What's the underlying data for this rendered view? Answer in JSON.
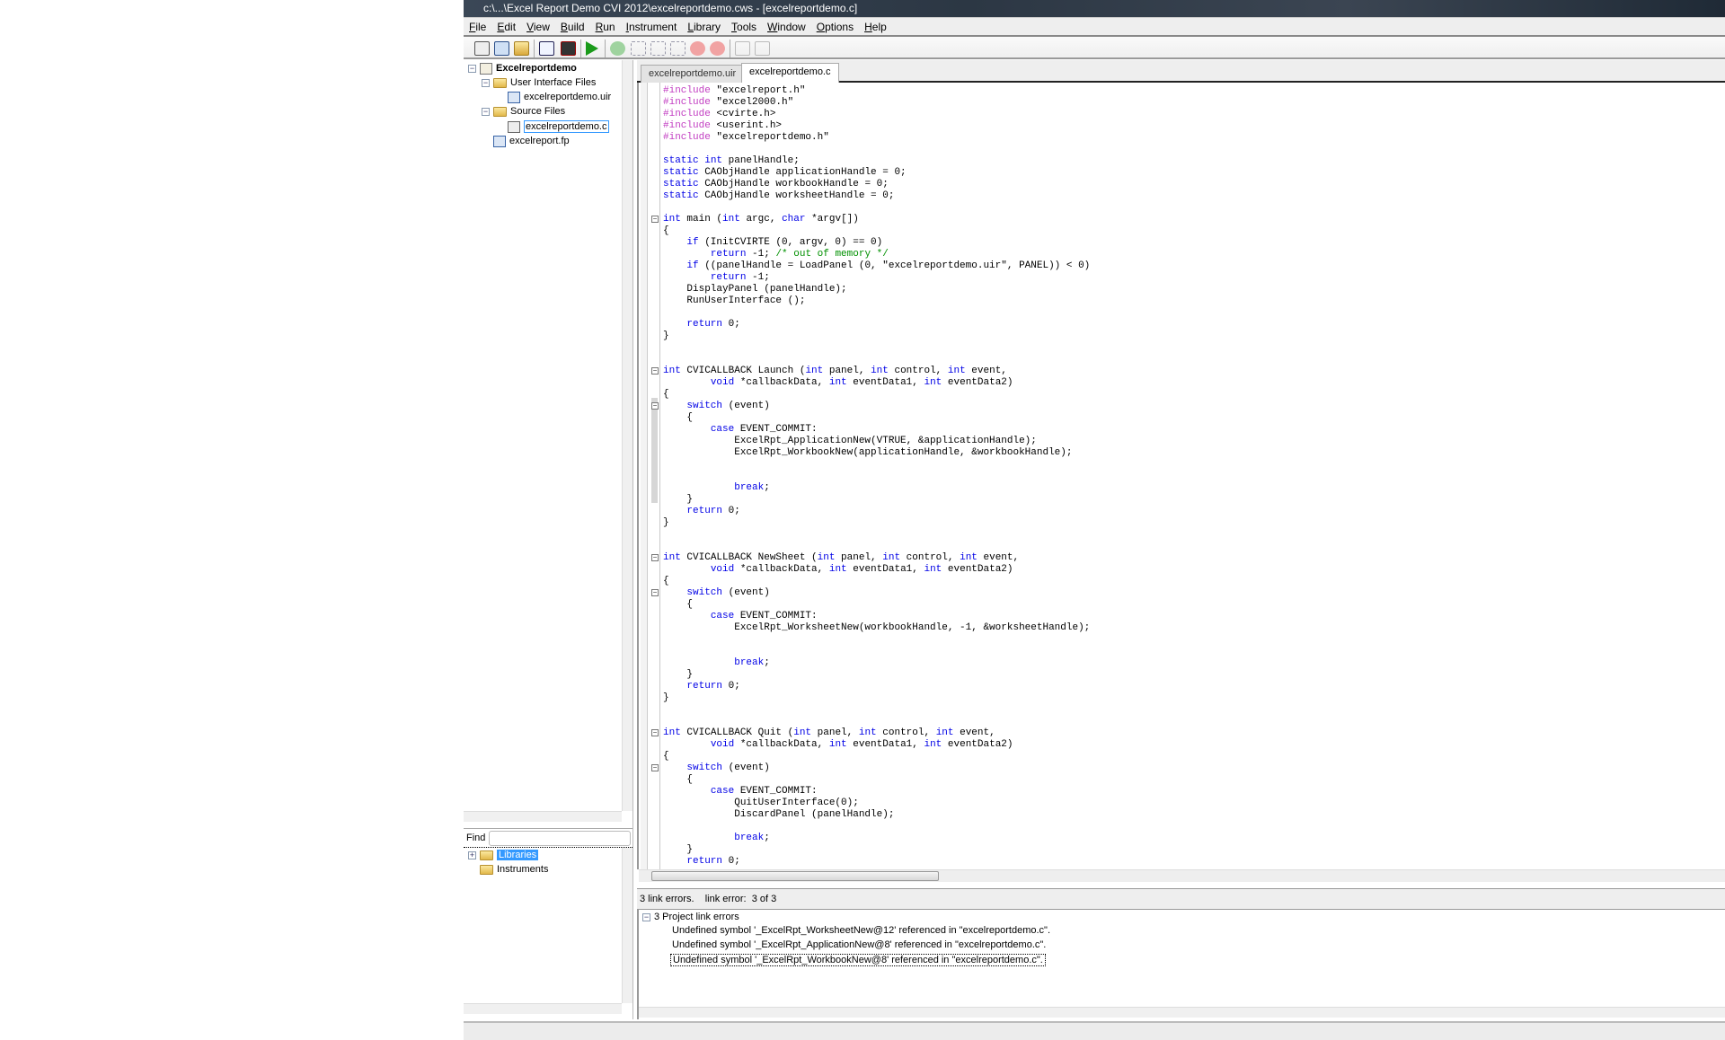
{
  "window": {
    "title": "c:\\...\\Excel Report Demo CVI 2012\\excelreportdemo.cws - [excelreportdemo.c]"
  },
  "menu": [
    "File",
    "Edit",
    "View",
    "Build",
    "Run",
    "Instrument",
    "Library",
    "Tools",
    "Window",
    "Options",
    "Help"
  ],
  "toolbar": {
    "icons": [
      "new-source-icon",
      "new-uir-icon",
      "open-icon",
      "function-tree-icon",
      "debug-target-icon",
      "run-icon",
      "go-icon",
      "step-into-icon",
      "step-over-icon",
      "step-out-icon",
      "stop-icon",
      "terminate-icon",
      "toggle-breakpoint-icon",
      "breakpoints-icon"
    ]
  },
  "project_tree": {
    "root": "Excelreportdemo",
    "user_interface_folder": "User Interface Files",
    "uir_file": "excelreportdemo.uir",
    "source_folder": "Source Files",
    "source_file": "excelreportdemo.c",
    "fp_file": "excelreport.fp"
  },
  "find": {
    "label": "Find",
    "value": ""
  },
  "library_tree": {
    "libraries": "Libraries",
    "instruments": "Instruments"
  },
  "tabs": [
    {
      "label": "excelreportdemo.uir",
      "active": false
    },
    {
      "label": "excelreportdemo.c",
      "active": true
    }
  ],
  "code": {
    "lines": [
      [
        [
          "p",
          "#include"
        ],
        [
          "t",
          " \"excelreport.h\""
        ]
      ],
      [
        [
          "p",
          "#include"
        ],
        [
          "t",
          " \"excel2000.h\""
        ]
      ],
      [
        [
          "p",
          "#include"
        ],
        [
          "t",
          " <cvirte.h>"
        ]
      ],
      [
        [
          "p",
          "#include"
        ],
        [
          "t",
          " <userint.h>"
        ]
      ],
      [
        [
          "p",
          "#include"
        ],
        [
          "t",
          " \"excelreportdemo.h\""
        ]
      ],
      [],
      [
        [
          "k",
          "static"
        ],
        [
          "t",
          " "
        ],
        [
          "k",
          "int"
        ],
        [
          "t",
          " panelHandle;"
        ]
      ],
      [
        [
          "k",
          "static"
        ],
        [
          "t",
          " CAObjHandle applicationHandle = 0;"
        ]
      ],
      [
        [
          "k",
          "static"
        ],
        [
          "t",
          " CAObjHandle workbookHandle = 0;"
        ]
      ],
      [
        [
          "k",
          "static"
        ],
        [
          "t",
          " CAObjHandle worksheetHandle = 0;"
        ]
      ],
      [],
      [
        [
          "k",
          "int"
        ],
        [
          "t",
          " main ("
        ],
        [
          "k",
          "int"
        ],
        [
          "t",
          " argc, "
        ],
        [
          "k",
          "char"
        ],
        [
          "t",
          " *argv[])"
        ]
      ],
      [
        [
          "t",
          "{"
        ]
      ],
      [
        [
          "t",
          "    "
        ],
        [
          "k",
          "if"
        ],
        [
          "t",
          " (InitCVIRTE (0, argv, 0) == 0)"
        ]
      ],
      [
        [
          "t",
          "        "
        ],
        [
          "k",
          "return"
        ],
        [
          "t",
          " -1; "
        ],
        [
          "c",
          "/* out of memory */"
        ]
      ],
      [
        [
          "t",
          "    "
        ],
        [
          "k",
          "if"
        ],
        [
          "t",
          " ((panelHandle = LoadPanel (0, \"excelreportdemo.uir\", PANEL)) < 0)"
        ]
      ],
      [
        [
          "t",
          "        "
        ],
        [
          "k",
          "return"
        ],
        [
          "t",
          " -1;"
        ]
      ],
      [
        [
          "t",
          "    DisplayPanel (panelHandle);"
        ]
      ],
      [
        [
          "t",
          "    RunUserInterface ();"
        ]
      ],
      [],
      [
        [
          "t",
          "    "
        ],
        [
          "k",
          "return"
        ],
        [
          "t",
          " 0;"
        ]
      ],
      [
        [
          "t",
          "}"
        ]
      ],
      [],
      [],
      [
        [
          "k",
          "int"
        ],
        [
          "t",
          " CVICALLBACK Launch ("
        ],
        [
          "k",
          "int"
        ],
        [
          "t",
          " panel, "
        ],
        [
          "k",
          "int"
        ],
        [
          "t",
          " control, "
        ],
        [
          "k",
          "int"
        ],
        [
          "t",
          " event,"
        ]
      ],
      [
        [
          "t",
          "        "
        ],
        [
          "k",
          "void"
        ],
        [
          "t",
          " *callbackData, "
        ],
        [
          "k",
          "int"
        ],
        [
          "t",
          " eventData1, "
        ],
        [
          "k",
          "int"
        ],
        [
          "t",
          " eventData2)"
        ]
      ],
      [
        [
          "t",
          "{"
        ]
      ],
      [
        [
          "t",
          "    "
        ],
        [
          "k",
          "switch"
        ],
        [
          "t",
          " (event)"
        ]
      ],
      [
        [
          "t",
          "    {"
        ]
      ],
      [
        [
          "t",
          "        "
        ],
        [
          "k",
          "case"
        ],
        [
          "t",
          " EVENT_COMMIT:"
        ]
      ],
      [
        [
          "t",
          "            ExcelRpt_ApplicationNew(VTRUE, &applicationHandle);"
        ]
      ],
      [
        [
          "t",
          "            ExcelRpt_WorkbookNew(applicationHandle, &workbookHandle);"
        ]
      ],
      [],
      [],
      [
        [
          "t",
          "            "
        ],
        [
          "k",
          "break"
        ],
        [
          "t",
          ";"
        ]
      ],
      [
        [
          "t",
          "    }"
        ]
      ],
      [
        [
          "t",
          "    "
        ],
        [
          "k",
          "return"
        ],
        [
          "t",
          " 0;"
        ]
      ],
      [
        [
          "t",
          "}"
        ]
      ],
      [],
      [],
      [
        [
          "k",
          "int"
        ],
        [
          "t",
          " CVICALLBACK NewSheet ("
        ],
        [
          "k",
          "int"
        ],
        [
          "t",
          " panel, "
        ],
        [
          "k",
          "int"
        ],
        [
          "t",
          " control, "
        ],
        [
          "k",
          "int"
        ],
        [
          "t",
          " event,"
        ]
      ],
      [
        [
          "t",
          "        "
        ],
        [
          "k",
          "void"
        ],
        [
          "t",
          " *callbackData, "
        ],
        [
          "k",
          "int"
        ],
        [
          "t",
          " eventData1, "
        ],
        [
          "k",
          "int"
        ],
        [
          "t",
          " eventData2)"
        ]
      ],
      [
        [
          "t",
          "{"
        ]
      ],
      [
        [
          "t",
          "    "
        ],
        [
          "k",
          "switch"
        ],
        [
          "t",
          " (event)"
        ]
      ],
      [
        [
          "t",
          "    {"
        ]
      ],
      [
        [
          "t",
          "        "
        ],
        [
          "k",
          "case"
        ],
        [
          "t",
          " EVENT_COMMIT:"
        ]
      ],
      [
        [
          "t",
          "            ExcelRpt_WorksheetNew(workbookHandle, -1, &worksheetHandle);"
        ]
      ],
      [],
      [],
      [
        [
          "t",
          "            "
        ],
        [
          "k",
          "break"
        ],
        [
          "t",
          ";"
        ]
      ],
      [
        [
          "t",
          "    }"
        ]
      ],
      [
        [
          "t",
          "    "
        ],
        [
          "k",
          "return"
        ],
        [
          "t",
          " 0;"
        ]
      ],
      [
        [
          "t",
          "}"
        ]
      ],
      [],
      [],
      [
        [
          "k",
          "int"
        ],
        [
          "t",
          " CVICALLBACK Quit ("
        ],
        [
          "k",
          "int"
        ],
        [
          "t",
          " panel, "
        ],
        [
          "k",
          "int"
        ],
        [
          "t",
          " control, "
        ],
        [
          "k",
          "int"
        ],
        [
          "t",
          " event,"
        ]
      ],
      [
        [
          "t",
          "        "
        ],
        [
          "k",
          "void"
        ],
        [
          "t",
          " *callbackData, "
        ],
        [
          "k",
          "int"
        ],
        [
          "t",
          " eventData1, "
        ],
        [
          "k",
          "int"
        ],
        [
          "t",
          " eventData2)"
        ]
      ],
      [
        [
          "t",
          "{"
        ]
      ],
      [
        [
          "t",
          "    "
        ],
        [
          "k",
          "switch"
        ],
        [
          "t",
          " (event)"
        ]
      ],
      [
        [
          "t",
          "    {"
        ]
      ],
      [
        [
          "t",
          "        "
        ],
        [
          "k",
          "case"
        ],
        [
          "t",
          " EVENT_COMMIT:"
        ]
      ],
      [
        [
          "t",
          "            QuitUserInterface(0);"
        ]
      ],
      [
        [
          "t",
          "            DiscardPanel (panelHandle);"
        ]
      ],
      [],
      [
        [
          "t",
          "            "
        ],
        [
          "k",
          "break"
        ],
        [
          "t",
          ";"
        ]
      ],
      [
        [
          "t",
          "    }"
        ]
      ],
      [
        [
          "t",
          "    "
        ],
        [
          "k",
          "return"
        ],
        [
          "t",
          " 0;"
        ]
      ]
    ],
    "fold_lines": [
      11,
      24,
      27,
      40,
      43,
      55,
      58
    ]
  },
  "errors": {
    "status": "3 link errors.    link error:  3 of 3",
    "group": "3 Project link errors",
    "items": [
      "Undefined symbol '_ExcelRpt_WorksheetNew@12' referenced in \"excelreportdemo.c\".",
      "Undefined symbol '_ExcelRpt_ApplicationNew@8' referenced in \"excelreportdemo.c\".",
      "Undefined symbol '_ExcelRpt_WorkbookNew@8' referenced in \"excelreportdemo.c\"."
    ],
    "selected_index": 2
  },
  "colors": {
    "keyword": "#0000e6",
    "preprocessor": "#c23ec2",
    "comment": "#009000",
    "selection": "#3399ff"
  }
}
